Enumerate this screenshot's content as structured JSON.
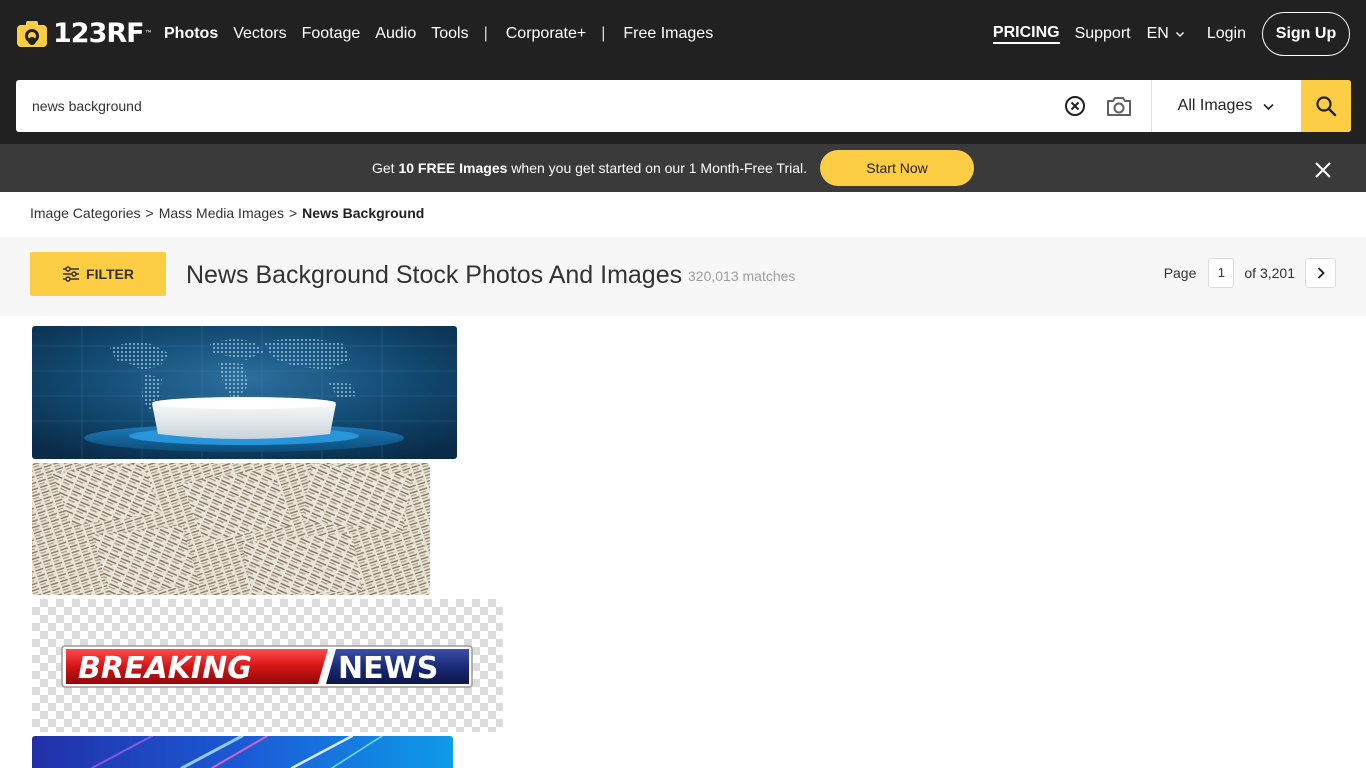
{
  "brand": {
    "logo_text": "123RF",
    "logo_mark": "™",
    "accent_color": "#fdcd44",
    "header_color": "#212121"
  },
  "nav": {
    "items": [
      {
        "label": "Photos",
        "active": true
      },
      {
        "label": "Vectors"
      },
      {
        "label": "Footage"
      },
      {
        "label": "Audio"
      },
      {
        "label": "Tools"
      },
      {
        "label": "Corporate+"
      },
      {
        "label": "Free Images"
      }
    ],
    "separator": "|",
    "pricing": "PRICING",
    "support": "Support",
    "language": "EN",
    "login": "Login",
    "signup": "Sign Up"
  },
  "search": {
    "value": "news background",
    "type_label": "All Images",
    "icons": {
      "clear": "clear-circle-icon",
      "camera": "camera-icon",
      "submit": "search-icon"
    }
  },
  "promo": {
    "text_before": "Get ",
    "text_bold": "10 FREE Images",
    "text_after": " when you get started on our 1 Month-Free Trial.",
    "cta": "Start Now",
    "close_icon": "close-icon"
  },
  "breadcrumb": {
    "items": [
      "Image Categories",
      "Mass Media Images"
    ],
    "separator": ">",
    "current": "News Background"
  },
  "results": {
    "filter_label": "FILTER",
    "title": "News Background Stock Photos And Images",
    "matches": "320,013 matches",
    "page_label": "Page",
    "page_value": "1",
    "page_total": "of 3,201"
  },
  "thumbnails": {
    "breaking_word": "BREAKING",
    "news_word": "NEWS"
  }
}
